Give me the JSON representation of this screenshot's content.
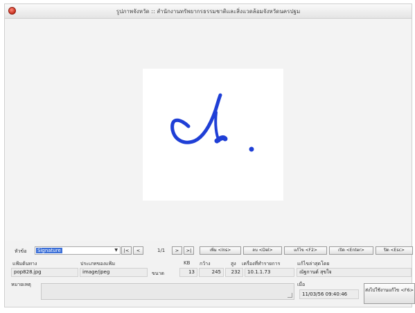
{
  "window": {
    "title": "รูปภาพจังหวัด :: สำนักงานทรัพยากรธรรมชาติและสิ่งแวดล้อมจังหวัดนครปฐม"
  },
  "viewer": {
    "image_description": "signature",
    "ink_color": "#1f3fd6"
  },
  "toolbar": {
    "topic_label": "หัวข้อ",
    "topic_value": "Signature",
    "first_label": "|<",
    "prev_label": "<",
    "page_indicator": "1/1",
    "next_label": ">",
    "last_label": ">|",
    "add_label": "เพิ่ม <Ins>",
    "delete_label": "ลบ <Del>",
    "edit_label": "แก้ไข <F2>",
    "open_label": "เปิด <Enter>",
    "close_label": "ปิด <Esc>"
  },
  "info": {
    "filename_label": "แฟ้มต้นทาง",
    "filename": "pop828.jpg",
    "filetype_label": "ประเภทของแฟ้ม",
    "filetype": "image/jpeg",
    "size_label": "ขนาด",
    "kb_label": "KB",
    "kb": "13",
    "width_label": "กว้าง",
    "width": "245",
    "height_label": "สูง",
    "height": "232",
    "machine_label": "เครื่องที่ทำรายการ",
    "machine": "10.1.1.73",
    "editor_label": "แก้ไขล่าสุดโดย",
    "editor": "ณัฐกานต์ สุขใจ",
    "note_label": "หมายเหตุ",
    "date_label": "เมื่อ",
    "datetime": "11/03/56 09:40:46",
    "use_button": "ส่งไปใช้งานแก้ไข <F6>"
  }
}
